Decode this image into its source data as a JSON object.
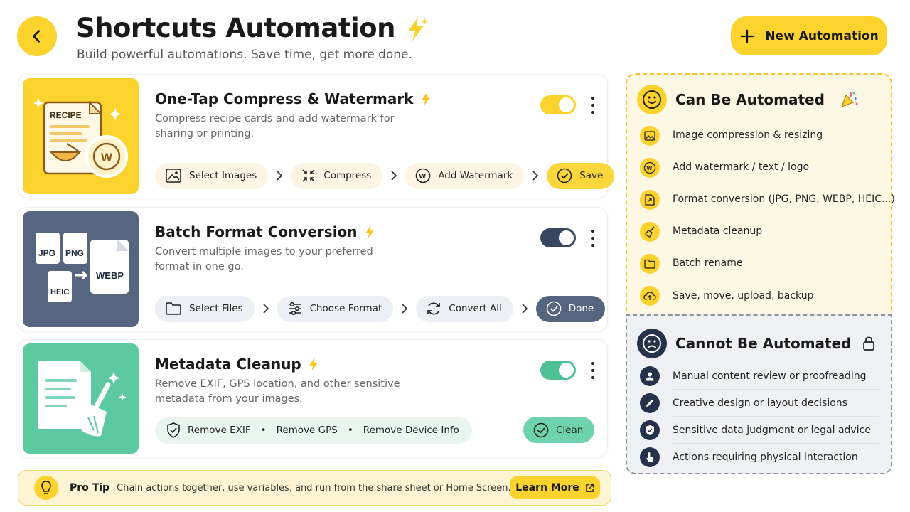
{
  "header": {
    "title": "Shortcuts Automation",
    "subtitle": "Build powerful automations. Save time, get more done.",
    "new_button": "New Automation"
  },
  "automations": [
    {
      "title": "One-Tap Compress & Watermark",
      "description": "Compress recipe cards and add watermark for sharing or printing.",
      "thumbnail_label": "RECIPE",
      "enabled": true,
      "toggle_color": "#fcd22d",
      "steps": [
        {
          "label": "Select Images",
          "icon": "image-icon"
        },
        {
          "label": "Compress",
          "icon": "compress-icon"
        },
        {
          "label": "Add Watermark",
          "icon": "watermark-icon"
        },
        {
          "label": "Save",
          "icon": "check-circle-icon"
        }
      ]
    },
    {
      "title": "Batch Format Conversion",
      "description": "Convert multiple images to your preferred format in one go.",
      "thumbnail_labels": [
        "JPG",
        "PNG",
        "HEIC",
        "WEBP"
      ],
      "enabled": true,
      "toggle_color": "#36475f",
      "steps": [
        {
          "label": "Select Files",
          "icon": "folder-icon"
        },
        {
          "label": "Choose Format",
          "icon": "sliders-icon"
        },
        {
          "label": "Convert All",
          "icon": "refresh-icon"
        },
        {
          "label": "Done",
          "icon": "check-circle-icon"
        }
      ]
    },
    {
      "title": "Metadata Cleanup",
      "description": "Remove EXIF, GPS location, and other sensitive metadata from your images.",
      "enabled": true,
      "toggle_color": "#4fbf95",
      "options": [
        "Remove EXIF",
        "Remove GPS",
        "Remove Device Info"
      ],
      "action": "Clean"
    }
  ],
  "can_automate": {
    "title": "Can Be Automated",
    "items": [
      {
        "label": "Image compression & resizing",
        "icon": "image-icon"
      },
      {
        "label": "Add watermark / text / logo",
        "icon": "watermark-icon"
      },
      {
        "label": "Format conversion (JPG, PNG, WEBP, HEIC...)",
        "icon": "file-convert-icon"
      },
      {
        "label": "Metadata cleanup",
        "icon": "broom-icon"
      },
      {
        "label": "Batch rename",
        "icon": "folder-icon"
      },
      {
        "label": "Save, move, upload, backup",
        "icon": "cloud-upload-icon"
      }
    ]
  },
  "cannot_automate": {
    "title": "Cannot Be Automated",
    "items": [
      {
        "label": "Manual content review or proofreading",
        "icon": "person-icon"
      },
      {
        "label": "Creative design or layout decisions",
        "icon": "pencil-icon"
      },
      {
        "label": "Sensitive data judgment or legal advice",
        "icon": "shield-check-icon"
      },
      {
        "label": "Actions requiring physical interaction",
        "icon": "hand-tap-icon"
      }
    ]
  },
  "tip": {
    "label": "Pro Tip",
    "text": "Chain actions together, use variables, and run from the share sheet or Home Screen.",
    "button": "Learn More"
  }
}
